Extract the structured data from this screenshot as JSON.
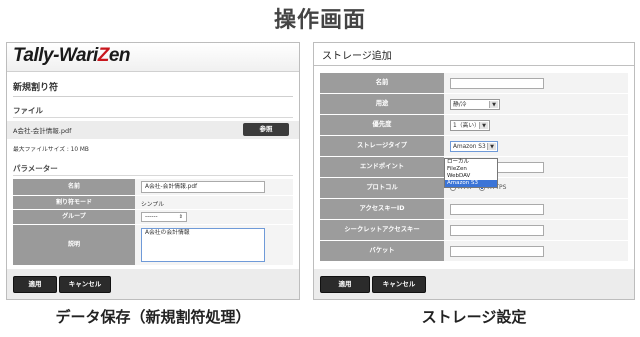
{
  "page_title": "操作画面",
  "left": {
    "brand": {
      "part1": "Tally-Wari",
      "part2": "Z",
      "part3": "en"
    },
    "subtitle": "新規割り符",
    "file_section": "ファイル",
    "file_name": "A会社-会計情報.pdf",
    "browse_label": "参照",
    "max_size": "最大ファイルサイズ : 10 MB",
    "param_section": "パラメーター",
    "params": [
      {
        "label": "名前",
        "value": "A会社-会計情報.pdf"
      },
      {
        "label": "割り符モード",
        "value": "シンプル"
      },
      {
        "label": "グループ",
        "value": "------"
      },
      {
        "label": "説明",
        "value": "A会社の会計情報"
      }
    ],
    "apply_label": "適用",
    "cancel_label": "キャンセル",
    "caption": "データ保存（新規割符処理）"
  },
  "right": {
    "title": "ストレージ追加",
    "rows": [
      {
        "label": "名前",
        "value": ""
      },
      {
        "label": "用途",
        "value": "静/冷"
      },
      {
        "label": "優先度",
        "value": "1（高い）"
      },
      {
        "label": "ストレージタイプ",
        "value": "Amazon S3"
      },
      {
        "label": "エンドポイント",
        "value": "m"
      },
      {
        "label": "プロトコル",
        "value": ""
      },
      {
        "label": "アクセスキーID",
        "value": ""
      },
      {
        "label": "シークレットアクセスキー",
        "value": ""
      },
      {
        "label": "バケット",
        "value": ""
      }
    ],
    "protocol_options": [
      "HTTP",
      "HTTPS"
    ],
    "protocol_selected": "HTTPS",
    "storage_options": [
      "ローカル",
      "FileZen",
      "WebDAV",
      "Amazon S3"
    ],
    "storage_selected": "Amazon S3",
    "apply_label": "適用",
    "cancel_label": "キャンセル",
    "caption": "ストレージ設定"
  },
  "colors": {
    "brand_red": "#c8161d",
    "key_gray": "#9a9a9a",
    "button_dark": "#2b2b2b",
    "select_blue": "#3b74d7"
  }
}
